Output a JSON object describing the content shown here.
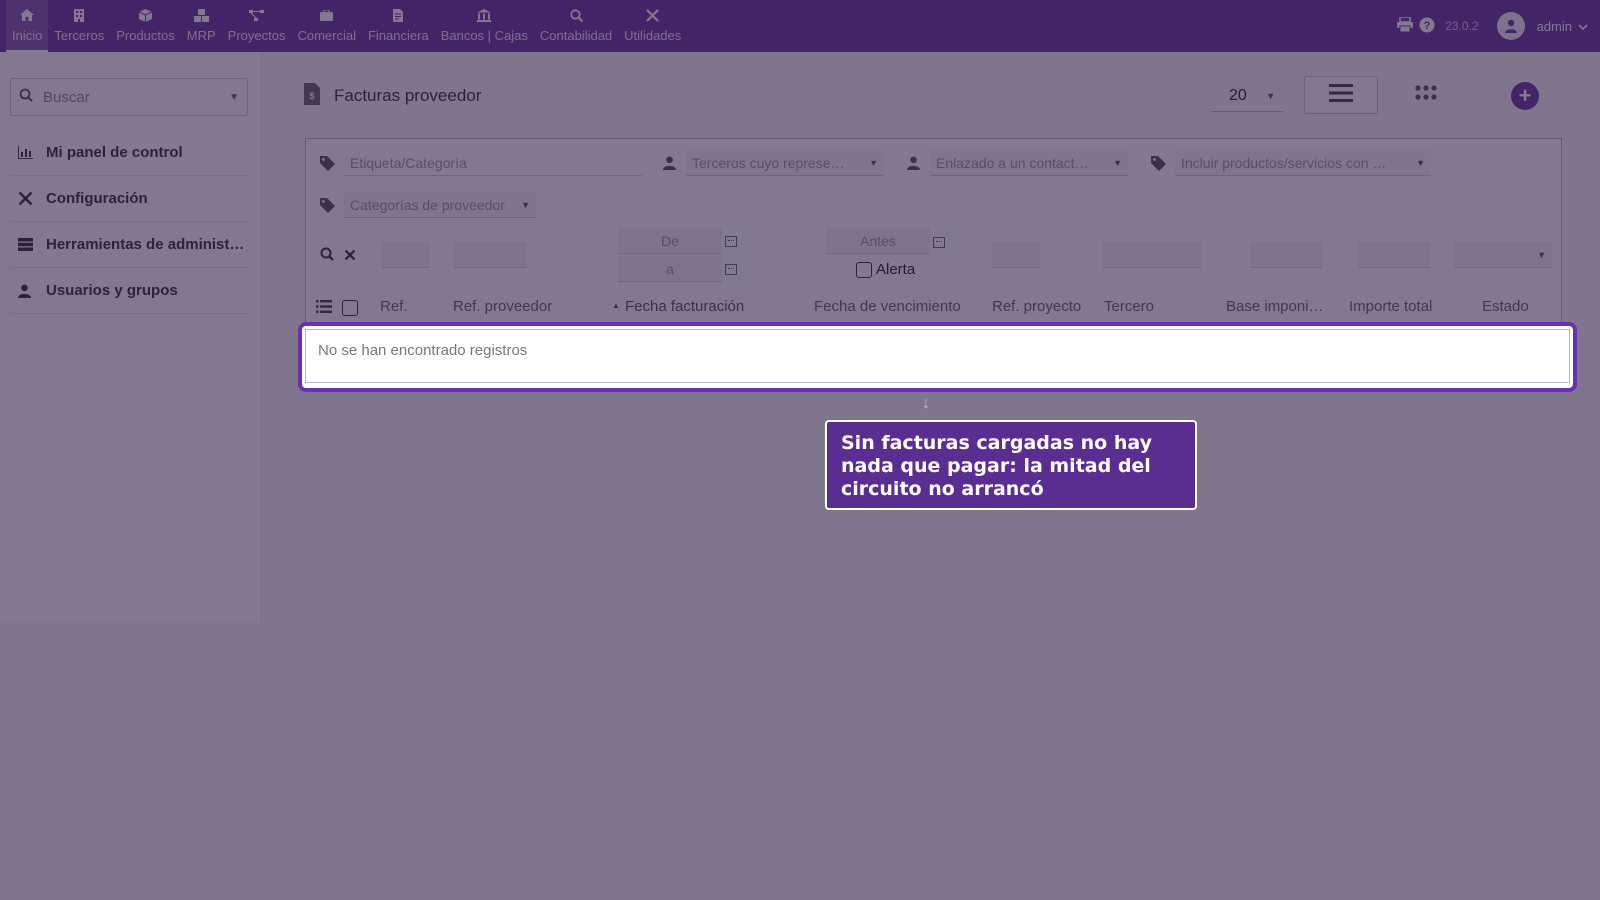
{
  "topbar": {
    "menu": [
      {
        "label": "Inicio",
        "icon": "home-icon",
        "active": true
      },
      {
        "label": "Terceros",
        "icon": "building-icon"
      },
      {
        "label": "Productos",
        "icon": "cube-icon"
      },
      {
        "label": "MRP",
        "icon": "cubes-icon"
      },
      {
        "label": "Proyectos",
        "icon": "project-diagram-icon"
      },
      {
        "label": "Comercial",
        "icon": "briefcase-icon"
      },
      {
        "label": "Financiera",
        "icon": "file-invoice-icon"
      },
      {
        "label": "Bancos | Cajas",
        "icon": "bank-icon"
      },
      {
        "label": "Contabilidad",
        "icon": "search-dollar-icon"
      },
      {
        "label": "Utilidades",
        "icon": "tools-icon"
      }
    ],
    "version": "23.0.2",
    "user": "admin"
  },
  "sidebar": {
    "search_placeholder": "Buscar",
    "items": [
      {
        "label": "Mi panel de control",
        "icon": "chart-bar-icon"
      },
      {
        "label": "Configuración",
        "icon": "tools-icon"
      },
      {
        "label": "Herramientas de administ…",
        "icon": "server-icon"
      },
      {
        "label": "Usuarios y grupos",
        "icon": "user-icon"
      }
    ]
  },
  "main": {
    "title": "Facturas proveedor",
    "limit": "20",
    "filters": {
      "tag_category": "Etiqueta/Categoría",
      "sales_rep": "Terceros cuyo represe…",
      "linked_contact": "Enlazado a un contact…",
      "include_products": "Incluir productos/servicios con …",
      "supplier_categories": "Categorías de proveedor",
      "date_from": "De",
      "date_to": "a",
      "due_before": "Antes",
      "alert_label": "Alerta"
    },
    "columns": [
      "Ref.",
      "Ref. proveedor",
      "Fecha facturación",
      "Fecha de vencimiento",
      "Ref. proyecto",
      "Tercero",
      "Base imponi…",
      "Importe total",
      "Estado"
    ],
    "empty_message": "No se han encontrado registros"
  },
  "callout": {
    "text": "Sin facturas cargadas no hay nada que pagar: la mitad del circuito no arrancó",
    "arrow": "↓"
  },
  "colors": {
    "brand": "#6a3ba0",
    "highlight": "#6a2fb3",
    "callout_bg": "#5a2d91"
  }
}
